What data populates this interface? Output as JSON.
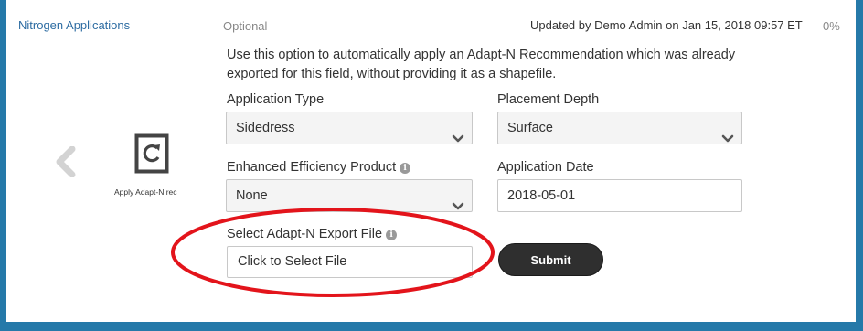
{
  "section": {
    "title": "Nitrogen Applications",
    "optional_label": "Optional",
    "updated_text": "Updated by Demo Admin on Jan 15, 2018 09:57 ET",
    "percent": "0%"
  },
  "description": "Use this option to automatically apply an Adapt-N Recommendation which was already exported for this field, without providing it as a shapefile.",
  "form": {
    "application_type": {
      "label": "Application Type",
      "value": "Sidedress"
    },
    "placement_depth": {
      "label": "Placement Depth",
      "value": "Surface"
    },
    "enhanced_efficiency": {
      "label": "Enhanced Efficiency Product",
      "value": "None"
    },
    "application_date": {
      "label": "Application Date",
      "value": "2018-05-01"
    },
    "export_file": {
      "label": "Select Adapt-N Export File",
      "value": "Click to Select File"
    },
    "submit_label": "Submit"
  },
  "sidebar": {
    "apply_caption": "Apply Adapt-N rec"
  },
  "icons": {
    "back": "chevron-left-icon",
    "apply": "refresh-document-icon",
    "info": "info-icon",
    "dropdown": "chevron-down-icon"
  },
  "colors": {
    "frame": "#2579a9",
    "link": "#2d6ca2",
    "submit_bg": "#2f2f2f",
    "highlight_ellipse": "#e3141b"
  }
}
